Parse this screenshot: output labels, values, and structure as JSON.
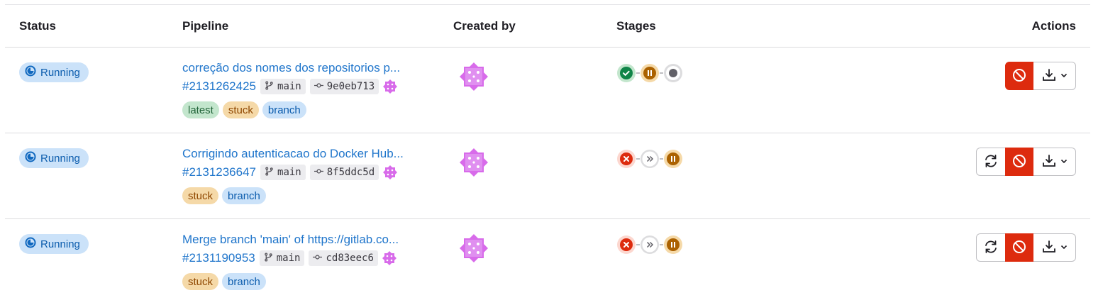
{
  "columns": {
    "status": "Status",
    "pipeline": "Pipeline",
    "created_by": "Created by",
    "stages": "Stages",
    "actions": "Actions"
  },
  "pipelines": [
    {
      "status": "Running",
      "title": "correção dos nomes dos repositorios p...",
      "id": "#2131262425",
      "branch": "main",
      "commit": "9e0eb713",
      "badges": [
        "latest",
        "stuck",
        "branch"
      ],
      "stages": [
        "success",
        "manual",
        "created"
      ],
      "can_retry": false
    },
    {
      "status": "Running",
      "title": "Corrigindo autenticacao do Docker Hub...",
      "id": "#2131236647",
      "branch": "main",
      "commit": "8f5ddc5d",
      "badges": [
        "stuck",
        "branch"
      ],
      "stages": [
        "failed",
        "skipped",
        "manual"
      ],
      "can_retry": true
    },
    {
      "status": "Running",
      "title": "Merge branch 'main' of https://gitlab.co...",
      "id": "#2131190953",
      "branch": "main",
      "commit": "cd83eec6",
      "badges": [
        "stuck",
        "branch"
      ],
      "stages": [
        "failed",
        "skipped",
        "manual"
      ],
      "can_retry": true
    }
  ],
  "colors": {
    "link": "#1f75cb",
    "running_bg": "#cbe2f9",
    "cancel": "#dd2b0e",
    "success": "#108548",
    "manual": "#ab6100",
    "failed": "#dd2b0e"
  }
}
